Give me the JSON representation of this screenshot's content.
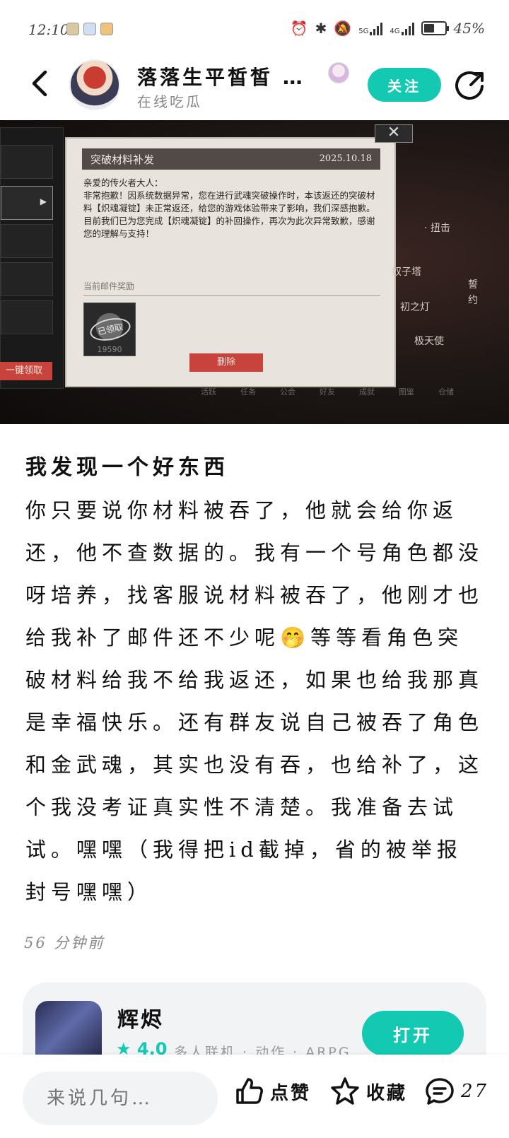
{
  "status_bar": {
    "time": "12:10",
    "signal1_label": "5G",
    "signal2_label": "4G",
    "battery": "45%"
  },
  "header": {
    "username": "落落生平皙皙 …",
    "subtitle": "在线吃瓜",
    "follow_label": "关注"
  },
  "screenshot": {
    "dialog_title": "突破材料补发",
    "dialog_date": "2025.10.18",
    "dialog_greeting": "亲爱的传火者大人：",
    "dialog_line1": "非常抱歉！因系统数据异常，您在进行武魂突破操作时，本该返还的突破材料【炽魂凝锭】未正常返还，给您的游戏体验带来了影响，我们深感抱歉。",
    "dialog_line2": "目前我们已为您完成【炽魂凝锭】的补回操作，再次为此次异常致歉，感谢您的理解与支持！",
    "reward_label": "当前邮件奖励",
    "item_stamp": "已领取",
    "item_number": "19590",
    "delete_label": "删除",
    "claim_all_label": "一键领取",
    "side_labels": [
      "· 扭击",
      "奴子塔",
      "誓约",
      "初之灯",
      "极天使"
    ],
    "bottom_nav": [
      "活跃",
      "任务",
      "公会",
      "好友",
      "成就",
      "图鉴",
      "仓储"
    ]
  },
  "post": {
    "title": "我发现一个好东西",
    "body": "你只要说你材料被吞了，他就会给你返还，他不查数据的。我有一个号角色都没呀培养，找客服说材料被吞了，他刚才也给我补了邮件还不少呢🤭等等看角色突破材料给我不给我返还，如果也给我那真是幸福快乐。还有群友说自己被吞了角色和金武魂，其实也没有吞，也给补了，这个我没考证真实性不清楚。我准备去试试。嘿嘿（我得把id截掉，省的被举报封号嘿嘿）",
    "time_ago": "56 分钟前"
  },
  "game_card": {
    "name": "辉烬",
    "rating": "4.0",
    "tags": "多人联机 · 动作 · ARPG",
    "open_label": "打开"
  },
  "bottom_bar": {
    "comment_placeholder": "来说几句…",
    "like_label": "点赞",
    "favorite_label": "收藏",
    "comment_count": "27"
  },
  "colors": {
    "accent": "#14c9b1",
    "mail_button": "#c8433b"
  }
}
